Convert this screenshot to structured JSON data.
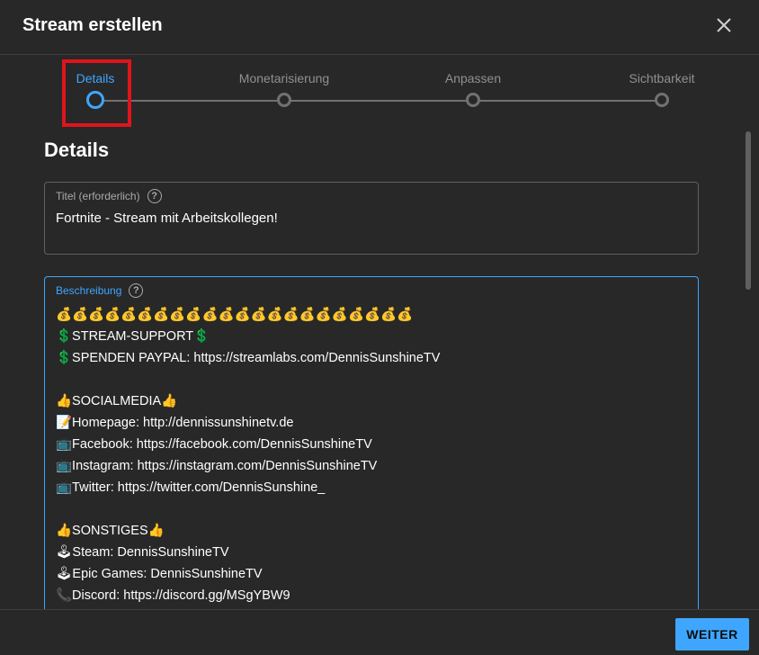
{
  "dialog": {
    "title": "Stream erstellen",
    "close_icon": "close-icon"
  },
  "stepper": {
    "steps": [
      {
        "label": "Details",
        "active": true
      },
      {
        "label": "Monetarisierung",
        "active": false
      },
      {
        "label": "Anpassen",
        "active": false
      },
      {
        "label": "Sichtbarkeit",
        "active": false
      }
    ]
  },
  "section": {
    "title": "Details"
  },
  "title_field": {
    "label": "Titel (erforderlich)",
    "value": "Fortnite - Stream mit Arbeitskollegen!",
    "help_icon": "?"
  },
  "description_field": {
    "label": "Beschreibung",
    "help_icon": "?",
    "lines": [
      "💰💰💰💰💰💰💰💰💰💰💰💰💰💰💰💰💰💰💰💰💰💰",
      "💲STREAM-SUPPORT💲",
      "💲SPENDEN PAYPAL: https://streamlabs.com/DennisSunshineTV",
      "",
      "👍SOCIALMEDIA👍",
      "📝Homepage: http://dennissunshinetv.de",
      "📺Facebook: https://facebook.com/DennisSunshineTV",
      "📺Instagram: https://instagram.com/DennisSunshineTV",
      "📺Twitter: https://twitter.com/DennisSunshine_",
      "",
      "👍SONSTIGES👍",
      "🕹Steam: DennisSunshineTV",
      "🕹Epic Games: DennisSunshineTV",
      "📞Discord: https://discord.gg/MSgYBW9"
    ]
  },
  "footer": {
    "next_label": "WEITER"
  },
  "colors": {
    "background": "#282828",
    "accent": "#3ea6ff",
    "highlight": "#e0141c",
    "inactive": "#717171"
  }
}
